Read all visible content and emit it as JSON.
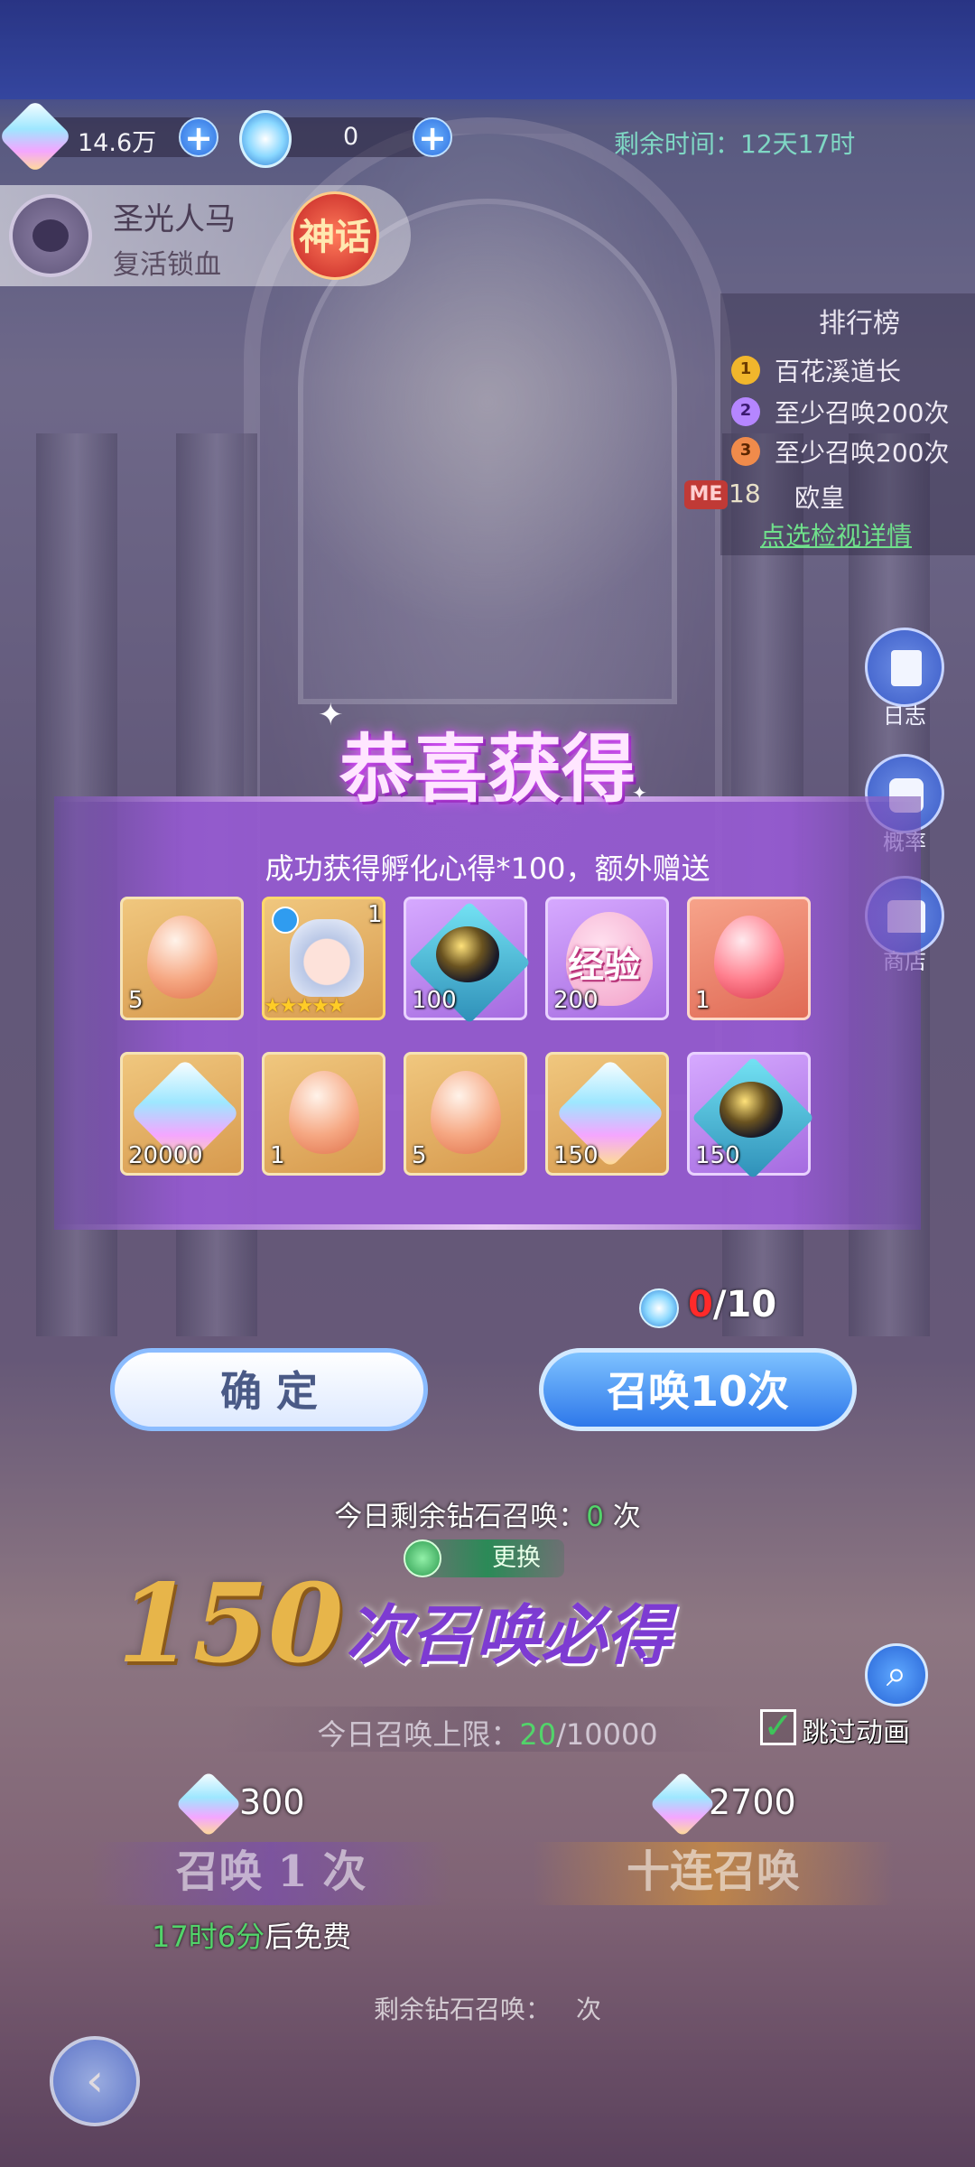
{
  "resources": {
    "diamond_amount": "14.6万",
    "ticket_amount": "0",
    "remaining_time": "剩余时间：12天17时"
  },
  "feature": {
    "title": "圣光人马",
    "subtitle": "复活锁血",
    "badge": "神话"
  },
  "ranking": {
    "title": "排行榜",
    "rows": [
      {
        "medal": "1",
        "text": "百花溪道长"
      },
      {
        "medal": "2",
        "text": "至少召唤200次"
      },
      {
        "medal": "3",
        "text": "至少召唤200次"
      }
    ],
    "me_tag": "ME",
    "me_rank": "18",
    "me_name": "欧皇",
    "link": "点选检视详情"
  },
  "side_buttons": [
    {
      "label": "日志",
      "icon": "log-icon"
    },
    {
      "label": "概率",
      "icon": "dice-icon"
    },
    {
      "label": "商店",
      "icon": "shop-icon"
    }
  ],
  "modal": {
    "title": "恭喜获得",
    "message": "成功获得孵化心得*100，额外赠送",
    "items_row1": [
      {
        "type": "orange-egg",
        "qty": "5"
      },
      {
        "type": "hero-card",
        "qty": "1",
        "stars": "★★★★★"
      },
      {
        "type": "black-egg",
        "qty": "100"
      },
      {
        "type": "exp-egg",
        "qty": "200",
        "text": "经验"
      },
      {
        "type": "red-egg",
        "qty": "1"
      }
    ],
    "items_row2": [
      {
        "type": "crystal",
        "qty": "20000"
      },
      {
        "type": "orange-egg",
        "qty": "1"
      },
      {
        "type": "orange-egg",
        "qty": "5"
      },
      {
        "type": "crystal",
        "qty": "150"
      },
      {
        "type": "black-egg",
        "qty": "150"
      }
    ]
  },
  "buttons": {
    "confirm": "确 定",
    "summon10": "召唤10次",
    "counter_current": "0",
    "counter_total": "/10"
  },
  "today": {
    "label": "今日剩余钻石召唤：",
    "value": "0",
    "unit": " 次"
  },
  "swap": {
    "label": "更换"
  },
  "guarantee": {
    "number": "150",
    "text": "次召唤必得"
  },
  "limit": {
    "label": "今日召唤上限：",
    "current": "20",
    "total": "/10000"
  },
  "skip": {
    "label": "跳过动画",
    "checked": true
  },
  "cost": {
    "single": "300",
    "ten": "2700"
  },
  "summon_buttons": {
    "single": "召唤 1 次",
    "ten": "十连召唤"
  },
  "free": {
    "time": "17时6分",
    "suffix": "后免费"
  },
  "remaining_summons": {
    "label": "剩余钻石召唤：",
    "unit": "次"
  },
  "colors": {
    "accent_green": "#52d46a",
    "counter_red": "#ff2a2a",
    "modal_purple": "#9a5ad2",
    "primary_blue": "#2e78ea"
  }
}
